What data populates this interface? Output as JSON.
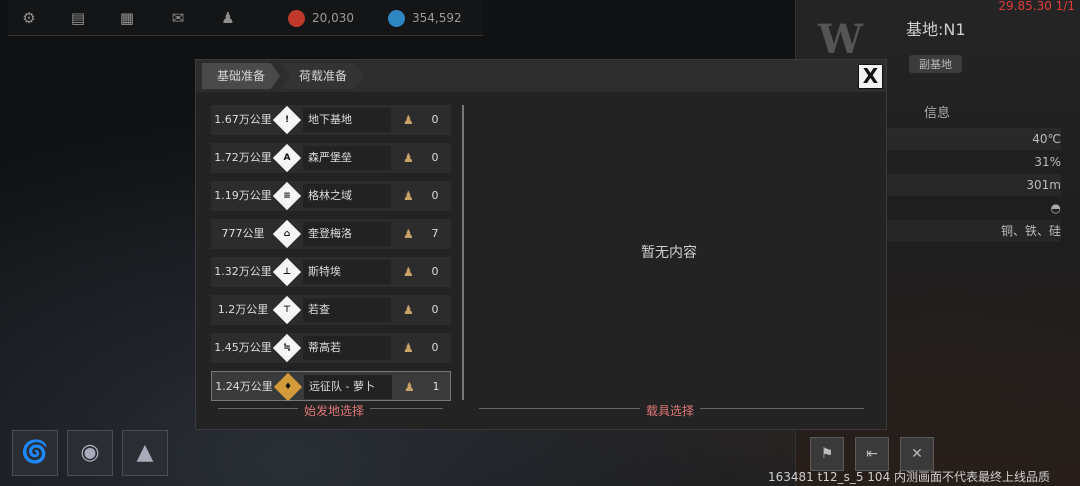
{
  "top_bar": {
    "icons": [
      "gear-icon",
      "chat-icon",
      "keyboard-icon",
      "mail-icon",
      "user-icon"
    ],
    "resource_1": {
      "value": "20,030",
      "color": "#c0392b"
    },
    "resource_2": {
      "value": "354,592",
      "color": "#2e86c1"
    }
  },
  "right_panel": {
    "coords": "29.85.30 1/1",
    "base_name": "基地:N1",
    "sub_tag": "副基地",
    "info_label": "信息",
    "rows": [
      "40℃",
      "31%",
      "301m",
      "",
      "铜、铁、硅"
    ]
  },
  "dialog": {
    "tabs": [
      "基础准备",
      "荷载准备"
    ],
    "close_label": "X",
    "locations": [
      {
        "distance": "1.67万公里",
        "icon": "!",
        "name": "地下基地",
        "count": "0"
      },
      {
        "distance": "1.72万公里",
        "icon": "A",
        "name": "森严堡垒",
        "count": "0"
      },
      {
        "distance": "1.19万公里",
        "icon": "≡",
        "name": "格林之域",
        "count": "0"
      },
      {
        "distance": "777公里",
        "icon": "⌂",
        "name": "奎登梅洛",
        "count": "7"
      },
      {
        "distance": "1.32万公里",
        "icon": "⊥",
        "name": "斯特埃",
        "count": "0"
      },
      {
        "distance": "1.2万公里",
        "icon": "⊤",
        "name": "若查",
        "count": "0"
      },
      {
        "distance": "1.45万公里",
        "icon": "≒",
        "name": "蒂高若",
        "count": "0"
      },
      {
        "distance": "1.24万公里",
        "icon": "♦",
        "name": "远征队 - 萝卜",
        "count": "1"
      }
    ],
    "empty_text": "暂无内容",
    "left_footer": "始发地选择",
    "right_footer": "载具选择"
  },
  "build_text": "163481 t12_s_5 104  内测画面不代表最终上线品质"
}
